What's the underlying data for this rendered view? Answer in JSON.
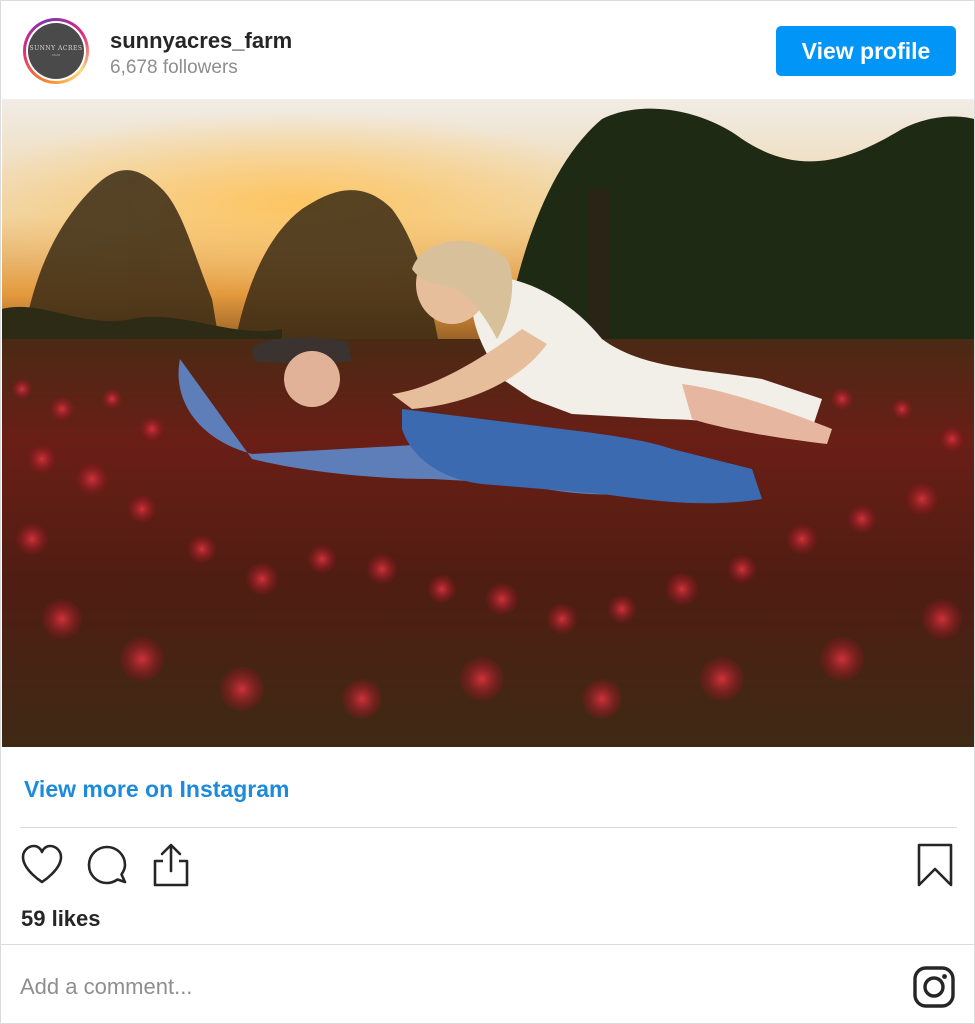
{
  "header": {
    "username": "sunnyacres_farm",
    "followers": "6,678 followers",
    "view_profile_label": "View profile",
    "avatar_logo_text": "SUNNY ACRES",
    "avatar_logo_sub": "FARM"
  },
  "post": {
    "view_more_label": "View more on Instagram",
    "likes": "59 likes",
    "comment_placeholder": "Add a comment..."
  },
  "icons": {
    "like": "heart-icon",
    "comment": "comment-icon",
    "share": "share-icon",
    "save": "bookmark-icon",
    "brand": "instagram-icon"
  },
  "colors": {
    "accent": "#0095f6",
    "link": "#1c8bdb",
    "muted": "#8e8e8e",
    "text": "#262626",
    "border": "#dbdbdb"
  }
}
